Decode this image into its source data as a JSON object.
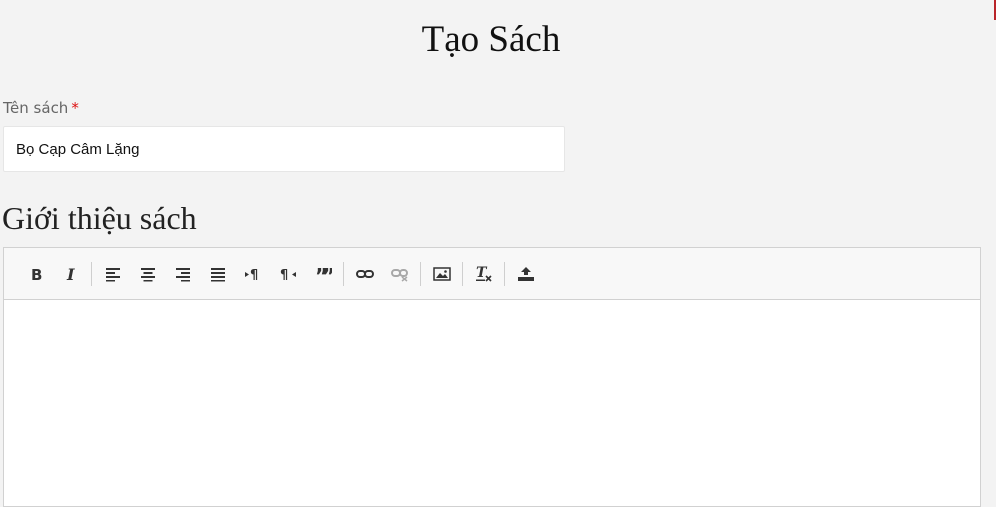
{
  "page": {
    "title": "Tạo Sách"
  },
  "book_name": {
    "label": "Tên sách",
    "required_mark": "*",
    "value": "Bọ Cạp Câm Lặng"
  },
  "intro": {
    "heading": "Giới thiệu sách",
    "content": ""
  },
  "toolbar": {
    "buttons": [
      {
        "icon": "bold-icon"
      },
      {
        "icon": "italic-icon"
      },
      {
        "icon": "align-left-icon"
      },
      {
        "icon": "align-center-icon"
      },
      {
        "icon": "align-right-icon"
      },
      {
        "icon": "justify-icon"
      },
      {
        "icon": "ltr-icon"
      },
      {
        "icon": "rtl-icon"
      },
      {
        "icon": "blockquote-icon"
      },
      {
        "icon": "link-icon"
      },
      {
        "icon": "unlink-icon",
        "disabled": true
      },
      {
        "icon": "image-icon"
      },
      {
        "icon": "clear-format-icon"
      },
      {
        "icon": "upload-icon"
      }
    ]
  },
  "colors": {
    "background": "#f3f3f3",
    "required": "#dd1111",
    "accent": "#b9252a"
  }
}
